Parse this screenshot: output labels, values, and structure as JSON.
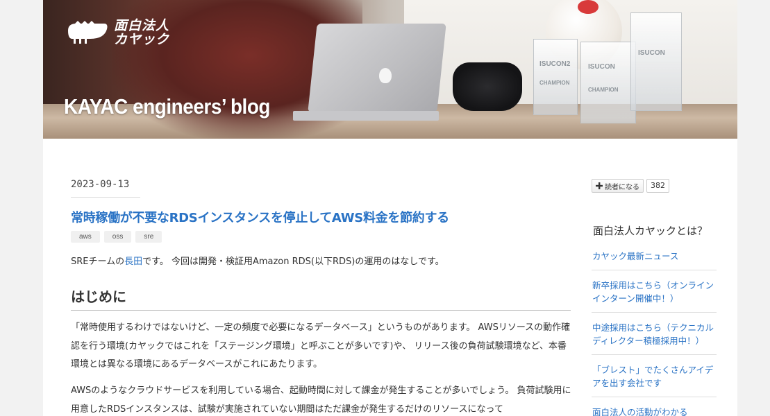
{
  "header": {
    "logo_text_line1": "面白法人",
    "logo_text_line2": "カヤック",
    "blog_title": "KAYAC engineers’ blog",
    "trophy_labels": [
      "ISUCON2",
      "ISUCON",
      "ISUCON",
      "CHAMPION",
      "CHAMPION"
    ]
  },
  "article": {
    "date": "2023-09-13",
    "title": "常時稼働が不要なRDSインスタンスを停止してAWS料金を節約する",
    "tags": [
      "aws",
      "oss",
      "sre"
    ],
    "intro_before": "SREチームの",
    "intro_link": "長田",
    "intro_after": "です。 今回は開発・検証用Amazon RDS(以下RDS)の運用のはなしです。",
    "section_heading": "はじめに",
    "paragraph1": "「常時使用するわけではないけど、一定の頻度で必要になるデータベース」というものがあります。 AWSリソースの動作確認を行う環境(カヤックではこれを「ステージング環境」と呼ぶことが多いです)や、 リリース後の負荷試験環境など、本番環境とは異なる環境にあるデータベースがこれにあたります。",
    "paragraph2": "AWSのようなクラウドサービスを利用している場合、起動時間に対して課金が発生することが多いでしょう。 負荷試験用に用意したRDSインスタンスは、試験が実施されていない期間はただ課金が発生するだけのリソースになって"
  },
  "sidebar": {
    "subscribe_label": "読者になる",
    "subscriber_count": "382",
    "about_title": "面白法人カヤックとは？",
    "links": [
      "カヤック最新ニュース",
      "新卒採用はこちら（オンラインインターン開催中！）",
      "中途採用はこちら（テクニカルディレクター積極採用中！）",
      "「ブレスト」でたくさんアイデアを出す会社です",
      "面白法人の活動がわかる"
    ]
  },
  "colors": {
    "link": "#2a73c5",
    "background": "#f2f2f2",
    "content_bg": "#ffffff"
  }
}
